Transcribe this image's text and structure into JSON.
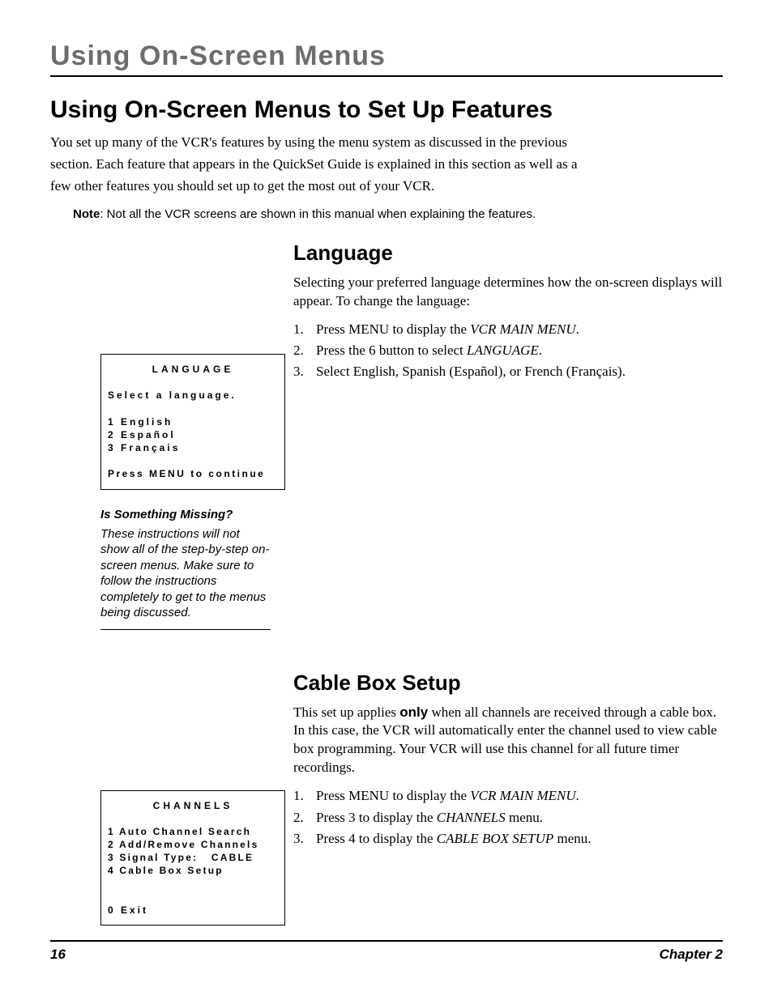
{
  "running_head": "Using On-Screen Menus",
  "section_title": "Using On-Screen Menus to Set Up Features",
  "intro_lines": [
    "You set up many of the VCR's features by using the menu system as discussed in the previous",
    "section. Each feature that appears in the QuickSet Guide is explained in this section as well as a",
    "few other features you should set up to get the most out of your VCR."
  ],
  "note": {
    "label": "Note",
    "text": ": Not all the VCR screens are shown in this manual when explaining the features."
  },
  "language": {
    "heading": "Language",
    "body": "Selecting your preferred language determines how the on-screen displays will appear. To change the language:",
    "steps": [
      {
        "num": "1.",
        "pre": "Press MENU to display the ",
        "it": "VCR MAIN MENU",
        "post": "."
      },
      {
        "num": "2.",
        "pre": "Press the 6 button to select ",
        "it": "LANGUAGE",
        "post": "."
      },
      {
        "num": "3.",
        "pre": "Select English, Spanish (Español), or French (Français).",
        "it": "",
        "post": ""
      }
    ],
    "screen": {
      "title": "LANGUAGE",
      "prompt": "Select a language.",
      "options": [
        "1 English",
        "2 Español",
        "3 Français"
      ],
      "footer": "Press MENU to continue"
    },
    "sidenote_title": "Is Something Missing?",
    "sidenote_body": "These instructions will not show all of the step-by-step on-screen menus. Make sure to follow the instructions completely to get to the menus being discussed."
  },
  "cable": {
    "heading": "Cable Box Setup",
    "body_pre": "This set up applies ",
    "body_bold": "only",
    "body_post": " when all channels are received through a cable box. In this case, the VCR will automatically enter the channel used to view cable box programming. Your VCR will use this channel for all future timer recordings.",
    "steps": [
      {
        "num": "1.",
        "pre": "Press MENU to display the ",
        "it": "VCR MAIN MENU",
        "post": "."
      },
      {
        "num": "2.",
        "pre": "Press 3 to display the ",
        "it": "CHANNELS",
        "post": " menu."
      },
      {
        "num": "3.",
        "pre": "Press 4 to display the ",
        "it": "CABLE BOX SETUP",
        "post": " menu."
      }
    ],
    "screen": {
      "title": "CHANNELS",
      "options": [
        "1 Auto Channel Search",
        "2 Add/Remove Channels",
        "3 Signal Type:   CABLE",
        "4 Cable Box Setup"
      ],
      "footer": "0 Exit"
    }
  },
  "footer": {
    "page": "16",
    "chapter": "Chapter 2"
  }
}
